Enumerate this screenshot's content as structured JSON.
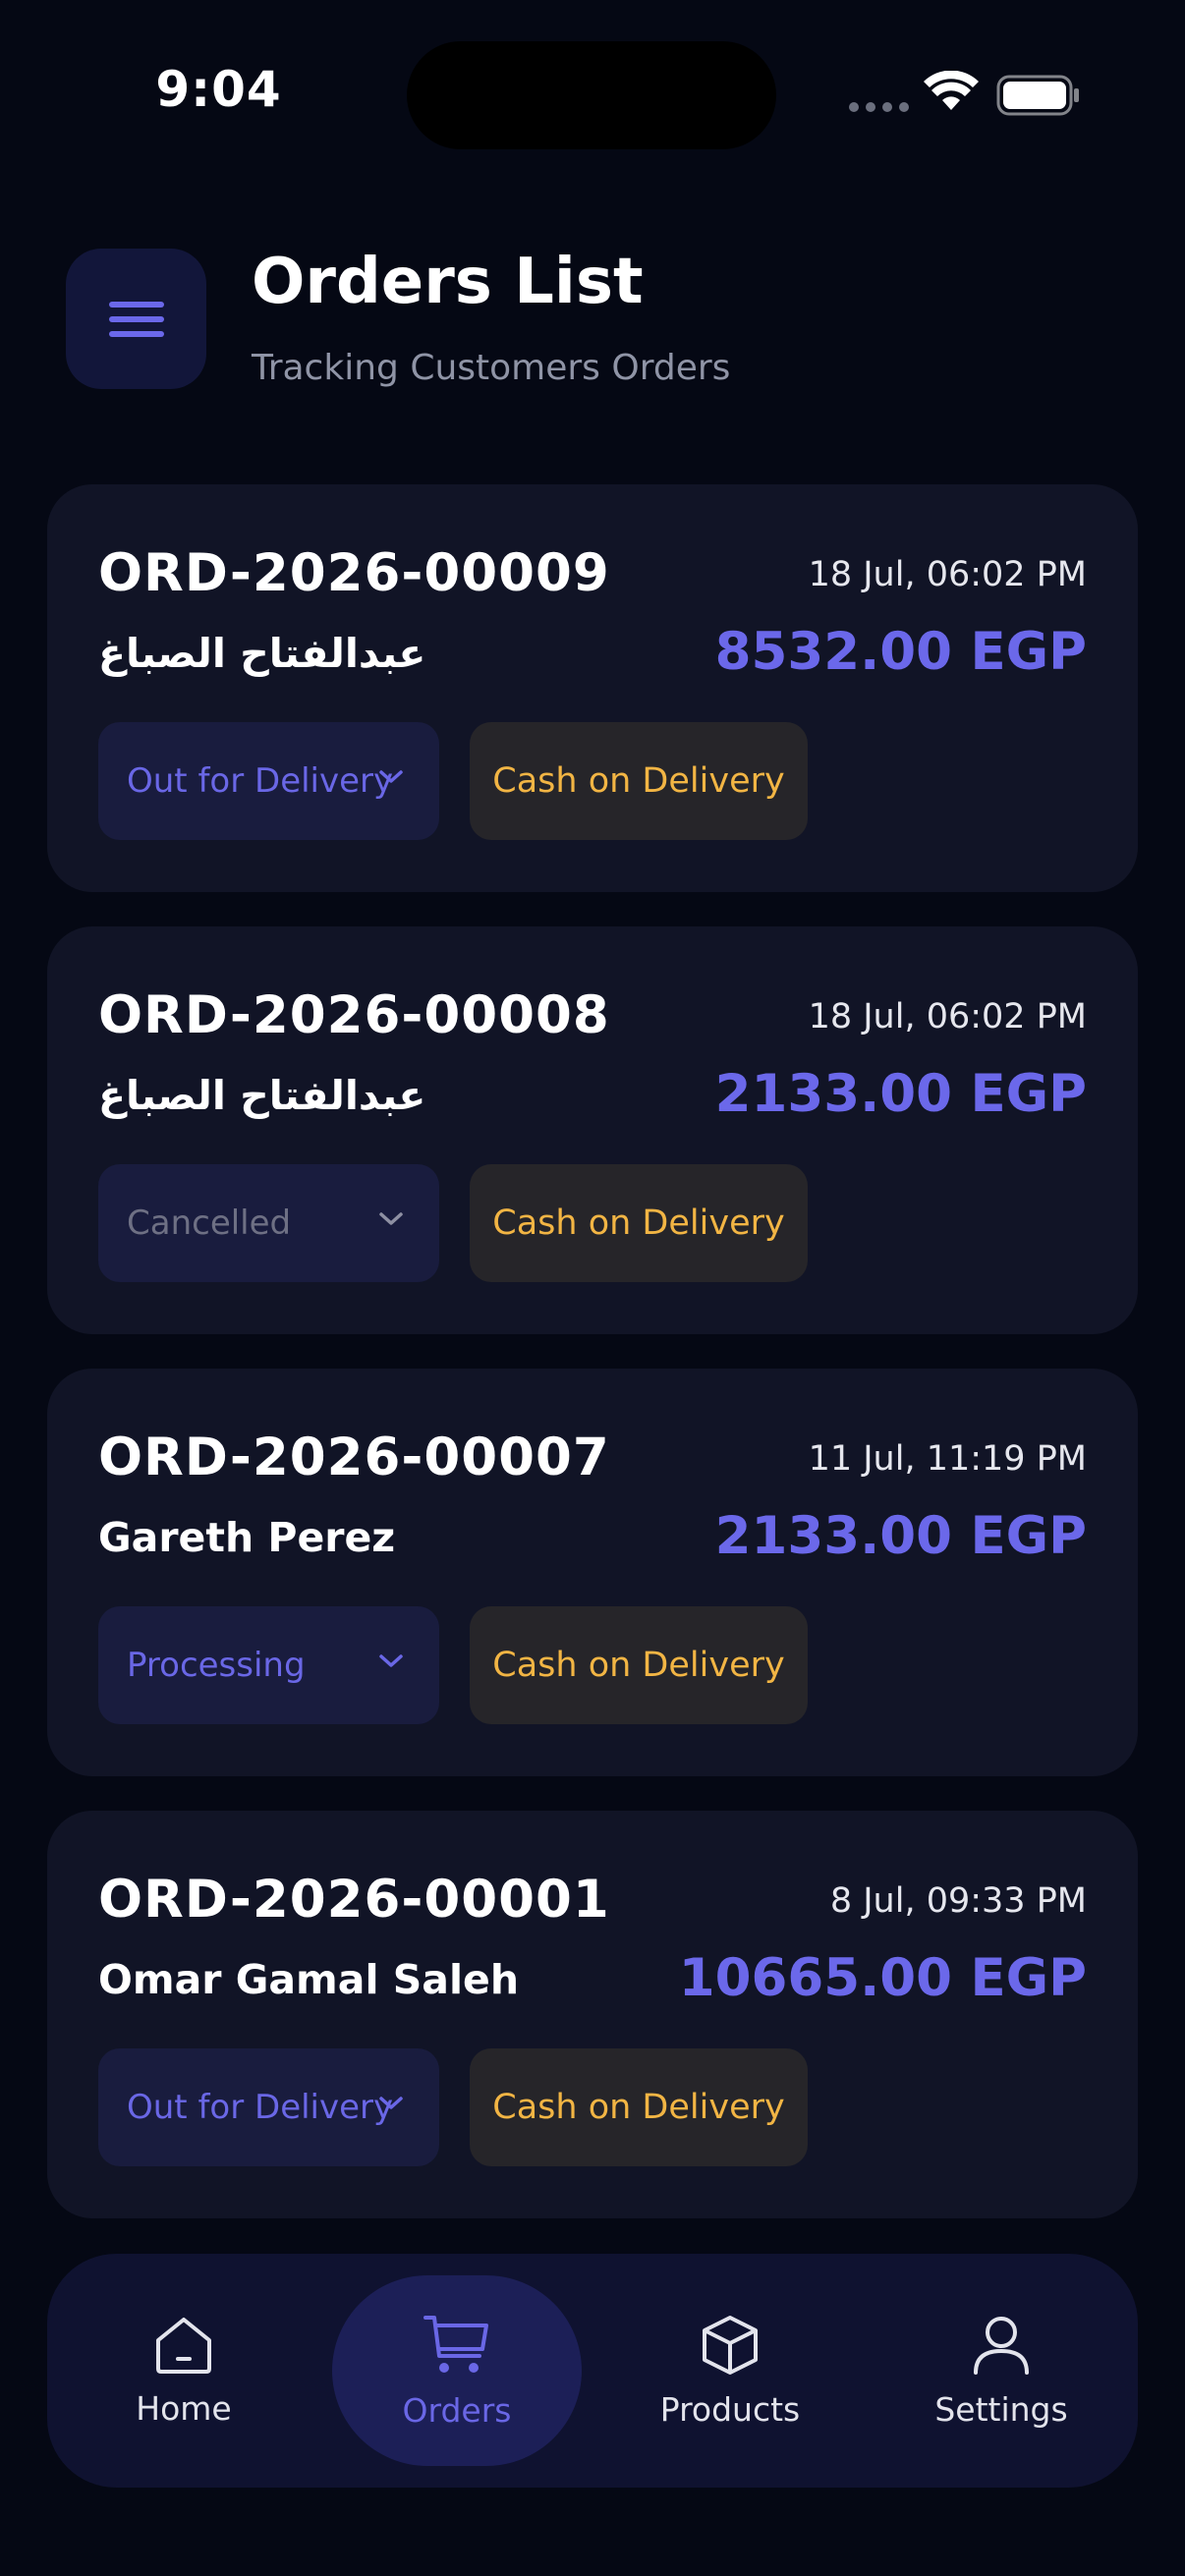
{
  "status_bar": {
    "time": "9:04"
  },
  "header": {
    "title": "Orders List",
    "subtitle": "Tracking Customers Orders"
  },
  "orders": [
    {
      "id": "ORD-2026-00009",
      "date": "18 Jul, 06:02 PM",
      "customer": "عبدالفتاح الصباغ",
      "amount": "8532.00 EGP",
      "status": "Out for Delivery",
      "payment": "Cash on Delivery"
    },
    {
      "id": "ORD-2026-00008",
      "date": "18 Jul, 06:02 PM",
      "customer": "عبدالفتاح الصباغ",
      "amount": "2133.00 EGP",
      "status": "Cancelled",
      "payment": "Cash on Delivery"
    },
    {
      "id": "ORD-2026-00007",
      "date": "11 Jul, 11:19 PM",
      "customer": "Gareth Perez",
      "amount": "2133.00 EGP",
      "status": "Processing",
      "payment": "Cash on Delivery"
    },
    {
      "id": "ORD-2026-00001",
      "date": "8 Jul, 09:33 PM",
      "customer": "Omar Gamal Saleh",
      "amount": "10665.00 EGP",
      "status": "Out for Delivery",
      "payment": "Cash on Delivery"
    }
  ],
  "nav": {
    "items": [
      {
        "label": "Home",
        "icon": "home-icon"
      },
      {
        "label": "Orders",
        "icon": "cart-icon",
        "active": true
      },
      {
        "label": "Products",
        "icon": "box-icon"
      },
      {
        "label": "Settings",
        "icon": "user-icon"
      }
    ]
  },
  "colors": {
    "background": "#050814",
    "card": "#111426",
    "accent": "#6b68ea",
    "payment_text": "#f2b544",
    "muted": "#8f94a6"
  }
}
